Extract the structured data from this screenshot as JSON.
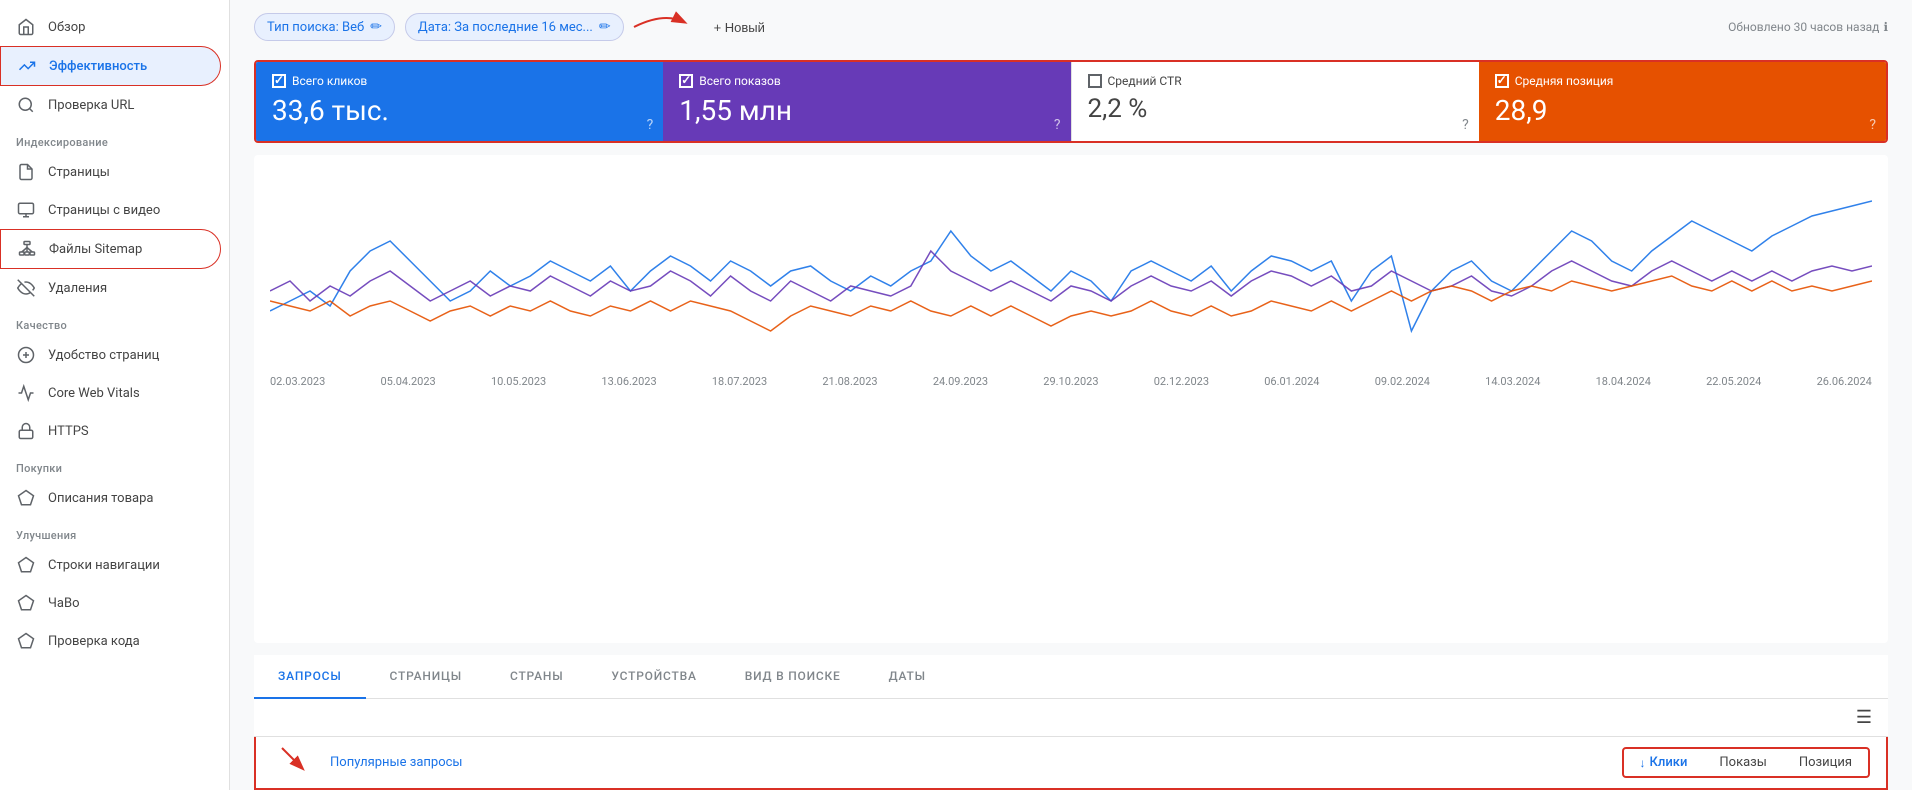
{
  "sidebar": {
    "items": [
      {
        "id": "overview",
        "label": "Обзор",
        "icon": "home"
      },
      {
        "id": "performance",
        "label": "Эффективность",
        "icon": "trending-up",
        "active": true
      },
      {
        "id": "url-check",
        "label": "Проверка URL",
        "icon": "search"
      },
      {
        "id": "section-indexing",
        "label": "Индексирование",
        "type": "section"
      },
      {
        "id": "pages",
        "label": "Страницы",
        "icon": "file"
      },
      {
        "id": "video-pages",
        "label": "Страницы с видео",
        "icon": "file-video"
      },
      {
        "id": "sitemap",
        "label": "Файлы Sitemap",
        "icon": "sitemap",
        "framed": true
      },
      {
        "id": "removals",
        "label": "Удаления",
        "icon": "eye-off"
      },
      {
        "id": "section-quality",
        "label": "Качество",
        "type": "section"
      },
      {
        "id": "page-experience",
        "label": "Удобство страниц",
        "icon": "star"
      },
      {
        "id": "core-web-vitals",
        "label": "Core Web Vitals",
        "icon": "activity"
      },
      {
        "id": "https",
        "label": "HTTPS",
        "icon": "lock"
      },
      {
        "id": "section-shopping",
        "label": "Покупки",
        "type": "section"
      },
      {
        "id": "product-descriptions",
        "label": "Описания товара",
        "icon": "diamond"
      },
      {
        "id": "section-improvements",
        "label": "Улучшения",
        "type": "section"
      },
      {
        "id": "breadcrumbs",
        "label": "Строки навигации",
        "icon": "diamond"
      },
      {
        "id": "faq",
        "label": "ЧаВо",
        "icon": "diamond"
      },
      {
        "id": "code-check",
        "label": "Проверка кода",
        "icon": "diamond"
      }
    ]
  },
  "topbar": {
    "filter1_label": "Тип поиска: Веб",
    "filter2_label": "Дата: За последние 16 мес...",
    "new_button_label": "+ Новый",
    "updated_label": "Обновлено 30 часов назад"
  },
  "metrics": [
    {
      "id": "clicks",
      "label": "Всего кликов",
      "value": "33,6 тыс.",
      "checked": true,
      "color": "blue"
    },
    {
      "id": "impressions",
      "label": "Всего показов",
      "value": "1,55 млн",
      "checked": true,
      "color": "purple"
    },
    {
      "id": "ctr",
      "label": "Средний CTR",
      "value": "2,2 %",
      "checked": false,
      "color": "white"
    },
    {
      "id": "position",
      "label": "Средняя позиция",
      "value": "28,9",
      "checked": true,
      "color": "orange"
    }
  ],
  "chart": {
    "dates": [
      "02.03.2023",
      "05.04.2023",
      "10.05.2023",
      "13.06.2023",
      "18.07.2023",
      "21.08.2023",
      "24.09.2023",
      "29.10.2023",
      "02.12.2023",
      "06.01.2024",
      "09.02.2024",
      "14.03.2024",
      "18.04.2024",
      "22.05.2024",
      "26.06.2024"
    ]
  },
  "tabs": [
    {
      "id": "queries",
      "label": "ЗАПРОСЫ",
      "active": true
    },
    {
      "id": "pages",
      "label": "СТРАНИЦЫ",
      "active": false
    },
    {
      "id": "countries",
      "label": "СТРАНЫ",
      "active": false
    },
    {
      "id": "devices",
      "label": "УСТРОЙСТВА",
      "active": false
    },
    {
      "id": "search-type",
      "label": "ВИД В ПОИСКЕ",
      "active": false
    },
    {
      "id": "dates",
      "label": "ДАТЫ",
      "active": false
    }
  ],
  "table": {
    "popular_queries_label": "Популярные запросы",
    "sort_columns": [
      {
        "id": "clicks",
        "label": "Клики",
        "active": true,
        "sort_icon": "↓"
      },
      {
        "id": "impressions",
        "label": "Показы",
        "active": false,
        "sort_icon": ""
      },
      {
        "id": "position",
        "label": "Позиция",
        "active": false,
        "sort_icon": ""
      }
    ]
  }
}
